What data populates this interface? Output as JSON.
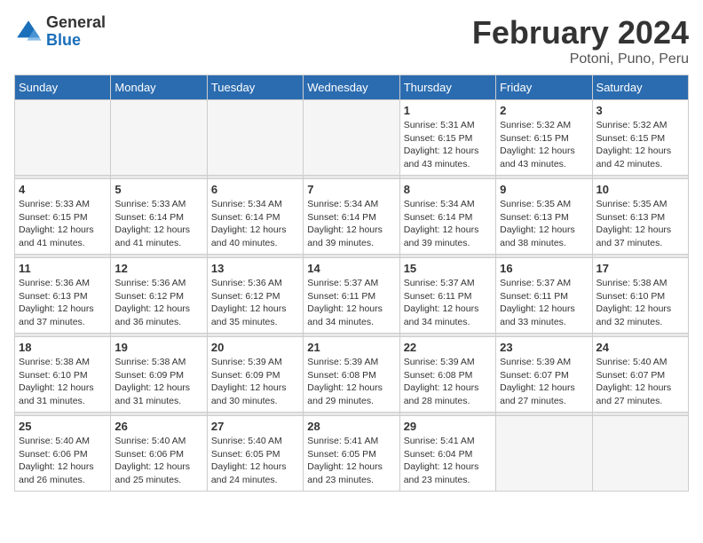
{
  "header": {
    "logo_general": "General",
    "logo_blue": "Blue",
    "month_title": "February 2024",
    "location": "Potoni, Puno, Peru"
  },
  "weekdays": [
    "Sunday",
    "Monday",
    "Tuesday",
    "Wednesday",
    "Thursday",
    "Friday",
    "Saturday"
  ],
  "weeks": [
    [
      {
        "day": "",
        "empty": true
      },
      {
        "day": "",
        "empty": true
      },
      {
        "day": "",
        "empty": true
      },
      {
        "day": "",
        "empty": true
      },
      {
        "day": "1",
        "sunrise": "5:31 AM",
        "sunset": "6:15 PM",
        "daylight": "12 hours and 43 minutes."
      },
      {
        "day": "2",
        "sunrise": "5:32 AM",
        "sunset": "6:15 PM",
        "daylight": "12 hours and 43 minutes."
      },
      {
        "day": "3",
        "sunrise": "5:32 AM",
        "sunset": "6:15 PM",
        "daylight": "12 hours and 42 minutes."
      }
    ],
    [
      {
        "day": "4",
        "sunrise": "5:33 AM",
        "sunset": "6:15 PM",
        "daylight": "12 hours and 41 minutes."
      },
      {
        "day": "5",
        "sunrise": "5:33 AM",
        "sunset": "6:14 PM",
        "daylight": "12 hours and 41 minutes."
      },
      {
        "day": "6",
        "sunrise": "5:34 AM",
        "sunset": "6:14 PM",
        "daylight": "12 hours and 40 minutes."
      },
      {
        "day": "7",
        "sunrise": "5:34 AM",
        "sunset": "6:14 PM",
        "daylight": "12 hours and 39 minutes."
      },
      {
        "day": "8",
        "sunrise": "5:34 AM",
        "sunset": "6:14 PM",
        "daylight": "12 hours and 39 minutes."
      },
      {
        "day": "9",
        "sunrise": "5:35 AM",
        "sunset": "6:13 PM",
        "daylight": "12 hours and 38 minutes."
      },
      {
        "day": "10",
        "sunrise": "5:35 AM",
        "sunset": "6:13 PM",
        "daylight": "12 hours and 37 minutes."
      }
    ],
    [
      {
        "day": "11",
        "sunrise": "5:36 AM",
        "sunset": "6:13 PM",
        "daylight": "12 hours and 37 minutes."
      },
      {
        "day": "12",
        "sunrise": "5:36 AM",
        "sunset": "6:12 PM",
        "daylight": "12 hours and 36 minutes."
      },
      {
        "day": "13",
        "sunrise": "5:36 AM",
        "sunset": "6:12 PM",
        "daylight": "12 hours and 35 minutes."
      },
      {
        "day": "14",
        "sunrise": "5:37 AM",
        "sunset": "6:11 PM",
        "daylight": "12 hours and 34 minutes."
      },
      {
        "day": "15",
        "sunrise": "5:37 AM",
        "sunset": "6:11 PM",
        "daylight": "12 hours and 34 minutes."
      },
      {
        "day": "16",
        "sunrise": "5:37 AM",
        "sunset": "6:11 PM",
        "daylight": "12 hours and 33 minutes."
      },
      {
        "day": "17",
        "sunrise": "5:38 AM",
        "sunset": "6:10 PM",
        "daylight": "12 hours and 32 minutes."
      }
    ],
    [
      {
        "day": "18",
        "sunrise": "5:38 AM",
        "sunset": "6:10 PM",
        "daylight": "12 hours and 31 minutes."
      },
      {
        "day": "19",
        "sunrise": "5:38 AM",
        "sunset": "6:09 PM",
        "daylight": "12 hours and 31 minutes."
      },
      {
        "day": "20",
        "sunrise": "5:39 AM",
        "sunset": "6:09 PM",
        "daylight": "12 hours and 30 minutes."
      },
      {
        "day": "21",
        "sunrise": "5:39 AM",
        "sunset": "6:08 PM",
        "daylight": "12 hours and 29 minutes."
      },
      {
        "day": "22",
        "sunrise": "5:39 AM",
        "sunset": "6:08 PM",
        "daylight": "12 hours and 28 minutes."
      },
      {
        "day": "23",
        "sunrise": "5:39 AM",
        "sunset": "6:07 PM",
        "daylight": "12 hours and 27 minutes."
      },
      {
        "day": "24",
        "sunrise": "5:40 AM",
        "sunset": "6:07 PM",
        "daylight": "12 hours and 27 minutes."
      }
    ],
    [
      {
        "day": "25",
        "sunrise": "5:40 AM",
        "sunset": "6:06 PM",
        "daylight": "12 hours and 26 minutes."
      },
      {
        "day": "26",
        "sunrise": "5:40 AM",
        "sunset": "6:06 PM",
        "daylight": "12 hours and 25 minutes."
      },
      {
        "day": "27",
        "sunrise": "5:40 AM",
        "sunset": "6:05 PM",
        "daylight": "12 hours and 24 minutes."
      },
      {
        "day": "28",
        "sunrise": "5:41 AM",
        "sunset": "6:05 PM",
        "daylight": "12 hours and 23 minutes."
      },
      {
        "day": "29",
        "sunrise": "5:41 AM",
        "sunset": "6:04 PM",
        "daylight": "12 hours and 23 minutes."
      },
      {
        "day": "",
        "empty": true
      },
      {
        "day": "",
        "empty": true
      }
    ]
  ]
}
